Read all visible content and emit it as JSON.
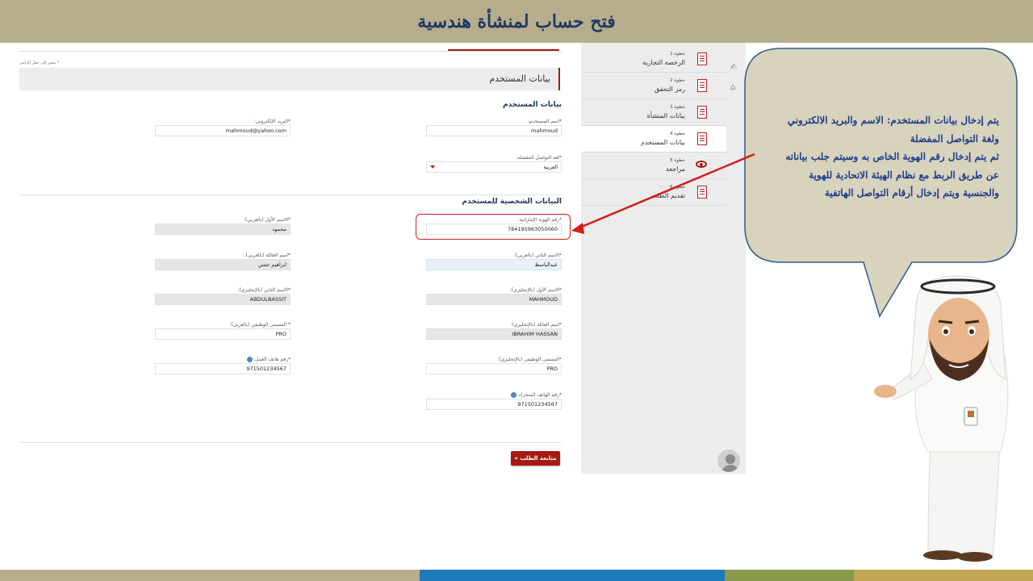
{
  "slide": {
    "title": "فتح حساب لمنشأة هندسية",
    "bottom_strip_colors": [
      "#b7ad8c",
      "#1e7ab8",
      "#8a9a4c",
      "#c4a455"
    ]
  },
  "form": {
    "required_note": "* تشير إلى حقل إلزامي",
    "section_header": "بيانات المستخدم",
    "user_section_title": "بيانات المستخدم",
    "fields": {
      "username": {
        "label": "*اسم المستخدم:",
        "value": "mahmoud"
      },
      "email": {
        "label": "*البريد الإلكتروني:",
        "value": "mahmoud@yahoo.com"
      },
      "language": {
        "label": "*لغة التواصل المفضلة:",
        "value": "العربية"
      }
    },
    "personal_section_title": "البيانات الشخصية للمستخدم",
    "personal_fields": {
      "emirates_id": {
        "label": "*رقم الهوية الإماراتية:",
        "value": "784195963050060"
      },
      "first_name_ar": {
        "label": "*الاسم الأول (بالعربي):",
        "value": "محمود"
      },
      "second_name_ar": {
        "label": "*الاسم الثاني (بالعربي):",
        "value": "عبدالباسط"
      },
      "family_name_ar": {
        "label": "*اسم العائلة (بالعربي):",
        "value": "ابراهيم حسن"
      },
      "first_name_en": {
        "label": "*الاسم الأول (بالإنجليزي):",
        "value": "MAHMOUD"
      },
      "second_name_en": {
        "label": "*الاسم الثاني (بالإنجليزي):",
        "value": "ABDULBASSIT"
      },
      "family_name_en": {
        "label": "*اسم العائلة (بالإنجليزي):",
        "value": "IBRAHIM HASSAN"
      },
      "job_title_ar": {
        "label": "* المسمى الوظيفي (بالعربي):",
        "value": "PRO"
      },
      "job_title_en": {
        "label": "*المسمى الوظيفي (بالإنجليزي):",
        "value": "PRO"
      },
      "work_phone": {
        "label": "*رقم هاتف العمل:",
        "value": "971501234567"
      },
      "mobile_phone": {
        "label": "*رقم الهاتف المتحرك:",
        "value": "971501234567"
      }
    },
    "continue_button": "متابعة الطلب »"
  },
  "steps": [
    {
      "num": "خطوة 1",
      "name": "الرخصة التجارية",
      "icon": "document-icon",
      "active": false
    },
    {
      "num": "خطوة 2",
      "name": "رمز التحقق",
      "icon": "document-icon",
      "active": false
    },
    {
      "num": "خطوة 3",
      "name": "بيانات المنشأة",
      "icon": "document-icon",
      "active": false
    },
    {
      "num": "خطوة 4",
      "name": "بيانات المستخدم",
      "icon": "document-icon",
      "active": true
    },
    {
      "num": "خطوة 5",
      "name": "مراجعة",
      "icon": "eye-icon",
      "active": false
    },
    {
      "num": "خطوة 6",
      "name": "تقديم الطلب",
      "icon": "document-icon",
      "active": false
    }
  ],
  "bubble": {
    "lines": [
      "يتم إدخال بيانات المستخدم: الاسم والبريد الالكتروني",
      "ولغة التواصل المفضلة",
      "ثم يتم إدخال رقم الهوية الخاص به وسيتم جلب بياناته",
      "عن طريق الربط مع نظام الهيئة الاتحادية للهوية",
      "والجنسية ويتم إدخال أرقام التواصل الهاتفية"
    ]
  },
  "colors": {
    "title_bar": "#b7ad8c",
    "title_text": "#1f3763",
    "accent_red": "#a61a10",
    "bubble_fill": "#d8d3bd",
    "bubble_stroke": "#2f5a8a",
    "bubble_text": "#1f3c8a"
  }
}
